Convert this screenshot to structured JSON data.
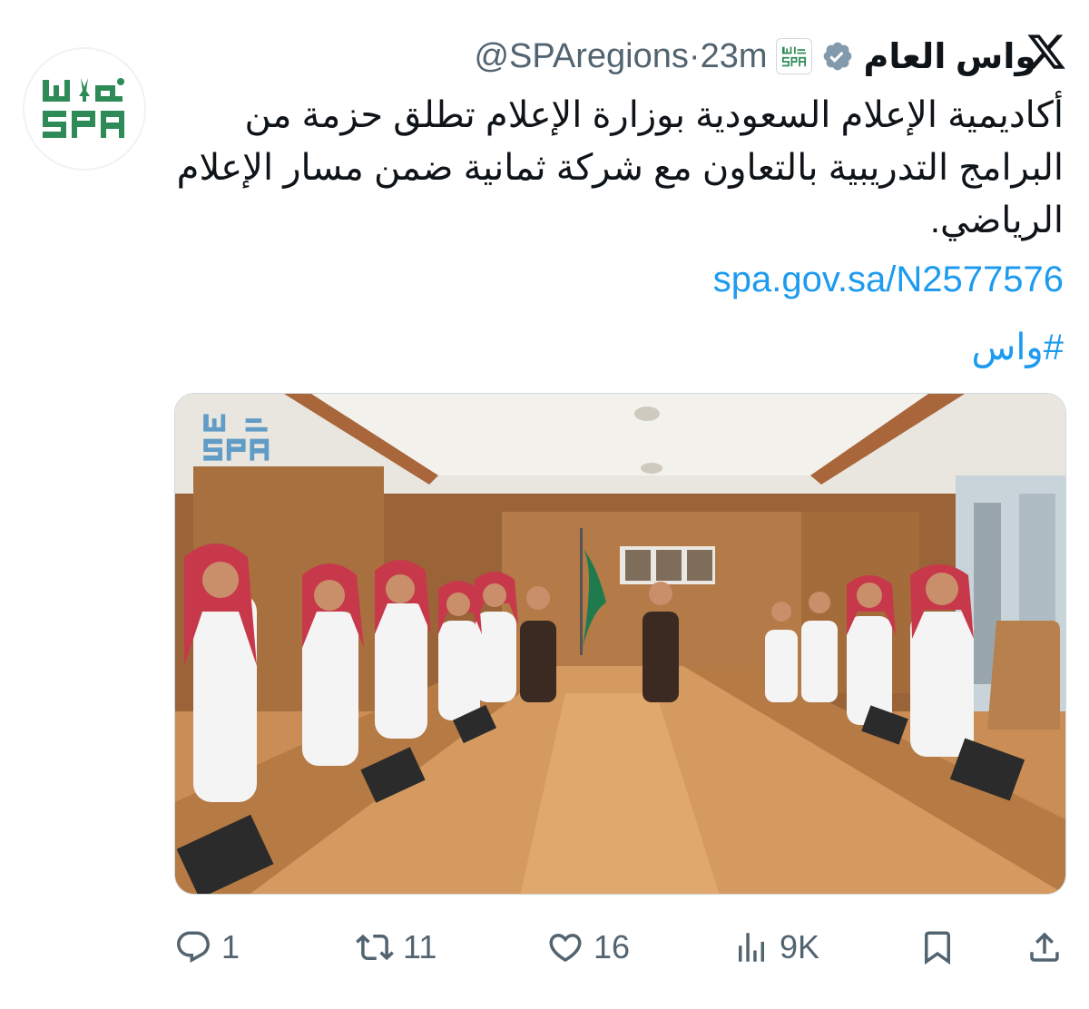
{
  "tweet": {
    "display_name": "واس العام",
    "handle": "@SPAregions",
    "separator": "·",
    "time": "23m",
    "text": "أكاديمية الإعلام السعودية بوزارة الإعلام تطلق حزمة من البرامج التدريبية بالتعاون مع شركة ثمانية ضمن مسار الإعلام الرياضي.",
    "link": "spa.gov.sa/N2577576",
    "hashtag": "#واس"
  },
  "branding": {
    "logo_text_top": "واس",
    "logo_text_bottom": "SPA",
    "brand_color": "#2e8b57",
    "link_color": "#1d9bf0",
    "muted_color": "#536471"
  },
  "actions": {
    "replies": "1",
    "reposts": "11",
    "likes": "16",
    "views": "9K"
  },
  "icons": {
    "reply": "reply-icon",
    "repost": "repost-icon",
    "like": "heart-icon",
    "views": "views-chart-icon",
    "bookmark": "bookmark-icon",
    "share": "share-icon",
    "x": "x-logo-icon",
    "verified": "verified-badge-icon"
  }
}
